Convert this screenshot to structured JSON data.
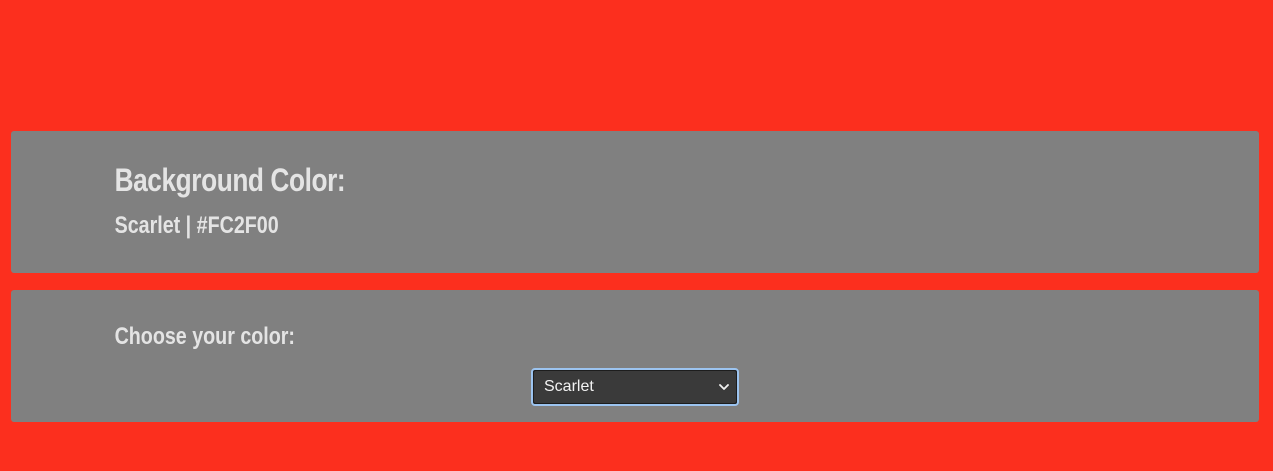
{
  "background": {
    "color_hex": "#FC2F1E"
  },
  "info_panel": {
    "title": "Background Color:",
    "current": "Scarlet | #FC2F00"
  },
  "picker_panel": {
    "label": "Choose your color:",
    "selected": "Scarlet"
  }
}
